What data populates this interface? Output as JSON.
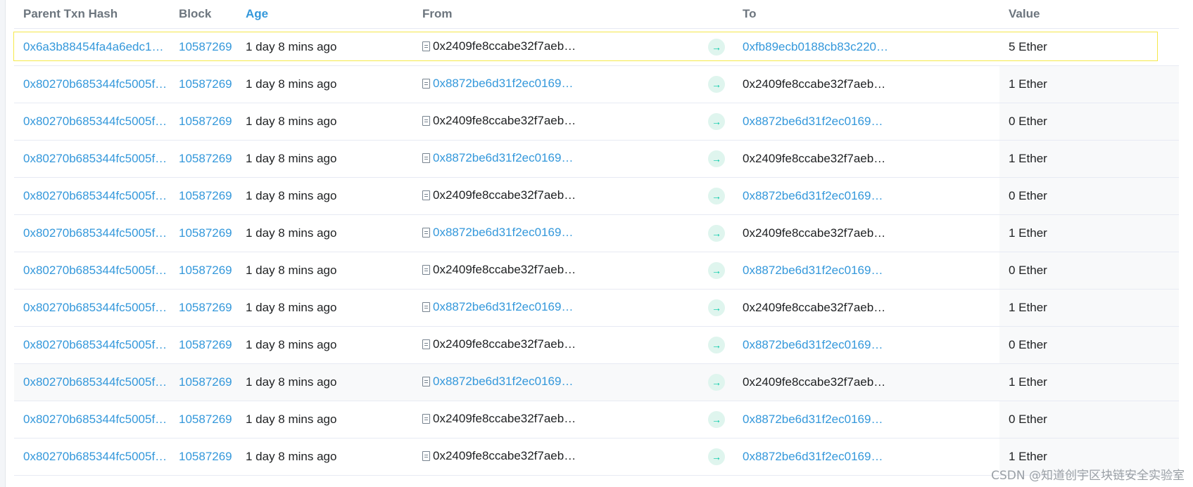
{
  "table": {
    "headers": {
      "parent_txn_hash": "Parent Txn Hash",
      "block": "Block",
      "age": "Age",
      "from": "From",
      "to": "To",
      "value": "Value"
    },
    "rows": [
      {
        "hash": "0x6a3b88454fa4a6edc1…",
        "block": "10587269",
        "age": "1 day 8 mins ago",
        "from": "0x2409fe8ccabe32f7aeb…",
        "from_is_link": false,
        "to": "0xfb89ecb0188cb83c220…",
        "to_is_link": true,
        "value": "5 Ether"
      },
      {
        "hash": "0x80270b685344fc5005f…",
        "block": "10587269",
        "age": "1 day 8 mins ago",
        "from": "0x8872be6d31f2ec0169…",
        "from_is_link": true,
        "to": "0x2409fe8ccabe32f7aeb…",
        "to_is_link": false,
        "value": "1 Ether"
      },
      {
        "hash": "0x80270b685344fc5005f…",
        "block": "10587269",
        "age": "1 day 8 mins ago",
        "from": "0x2409fe8ccabe32f7aeb…",
        "from_is_link": false,
        "to": "0x8872be6d31f2ec0169…",
        "to_is_link": true,
        "value": "0 Ether"
      },
      {
        "hash": "0x80270b685344fc5005f…",
        "block": "10587269",
        "age": "1 day 8 mins ago",
        "from": "0x8872be6d31f2ec0169…",
        "from_is_link": true,
        "to": "0x2409fe8ccabe32f7aeb…",
        "to_is_link": false,
        "value": "1 Ether"
      },
      {
        "hash": "0x80270b685344fc5005f…",
        "block": "10587269",
        "age": "1 day 8 mins ago",
        "from": "0x2409fe8ccabe32f7aeb…",
        "from_is_link": false,
        "to": "0x8872be6d31f2ec0169…",
        "to_is_link": true,
        "value": "0 Ether"
      },
      {
        "hash": "0x80270b685344fc5005f…",
        "block": "10587269",
        "age": "1 day 8 mins ago",
        "from": "0x8872be6d31f2ec0169…",
        "from_is_link": true,
        "to": "0x2409fe8ccabe32f7aeb…",
        "to_is_link": false,
        "value": "1 Ether"
      },
      {
        "hash": "0x80270b685344fc5005f…",
        "block": "10587269",
        "age": "1 day 8 mins ago",
        "from": "0x2409fe8ccabe32f7aeb…",
        "from_is_link": false,
        "to": "0x8872be6d31f2ec0169…",
        "to_is_link": true,
        "value": "0 Ether"
      },
      {
        "hash": "0x80270b685344fc5005f…",
        "block": "10587269",
        "age": "1 day 8 mins ago",
        "from": "0x8872be6d31f2ec0169…",
        "from_is_link": true,
        "to": "0x2409fe8ccabe32f7aeb…",
        "to_is_link": false,
        "value": "1 Ether"
      },
      {
        "hash": "0x80270b685344fc5005f…",
        "block": "10587269",
        "age": "1 day 8 mins ago",
        "from": "0x2409fe8ccabe32f7aeb…",
        "from_is_link": false,
        "to": "0x8872be6d31f2ec0169…",
        "to_is_link": true,
        "value": "0 Ether"
      },
      {
        "hash": "0x80270b685344fc5005f…",
        "block": "10587269",
        "age": "1 day 8 mins ago",
        "from": "0x8872be6d31f2ec0169…",
        "from_is_link": true,
        "to": "0x2409fe8ccabe32f7aeb…",
        "to_is_link": false,
        "value": "1 Ether"
      },
      {
        "hash": "0x80270b685344fc5005f…",
        "block": "10587269",
        "age": "1 day 8 mins ago",
        "from": "0x2409fe8ccabe32f7aeb…",
        "from_is_link": false,
        "to": "0x8872be6d31f2ec0169…",
        "to_is_link": true,
        "value": "0 Ether"
      },
      {
        "hash": "0x80270b685344fc5005f…",
        "block": "10587269",
        "age": "1 day 8 mins ago",
        "from": "0x2409fe8ccabe32f7aeb…",
        "from_is_link": false,
        "to": "0x8872be6d31f2ec0169…",
        "to_is_link": true,
        "value": "1 Ether"
      }
    ]
  },
  "icons": {
    "contract": "file-text-icon",
    "direction": "arrow-right-icon",
    "direction_glyph": "→"
  },
  "colors": {
    "link": "#3498db",
    "text": "#1e2022",
    "header": "#6c757e",
    "arrow": "#00c9a7",
    "highlight_border": "#f5e84a"
  },
  "watermark": "CSDN @知道创宇区块链安全实验室"
}
